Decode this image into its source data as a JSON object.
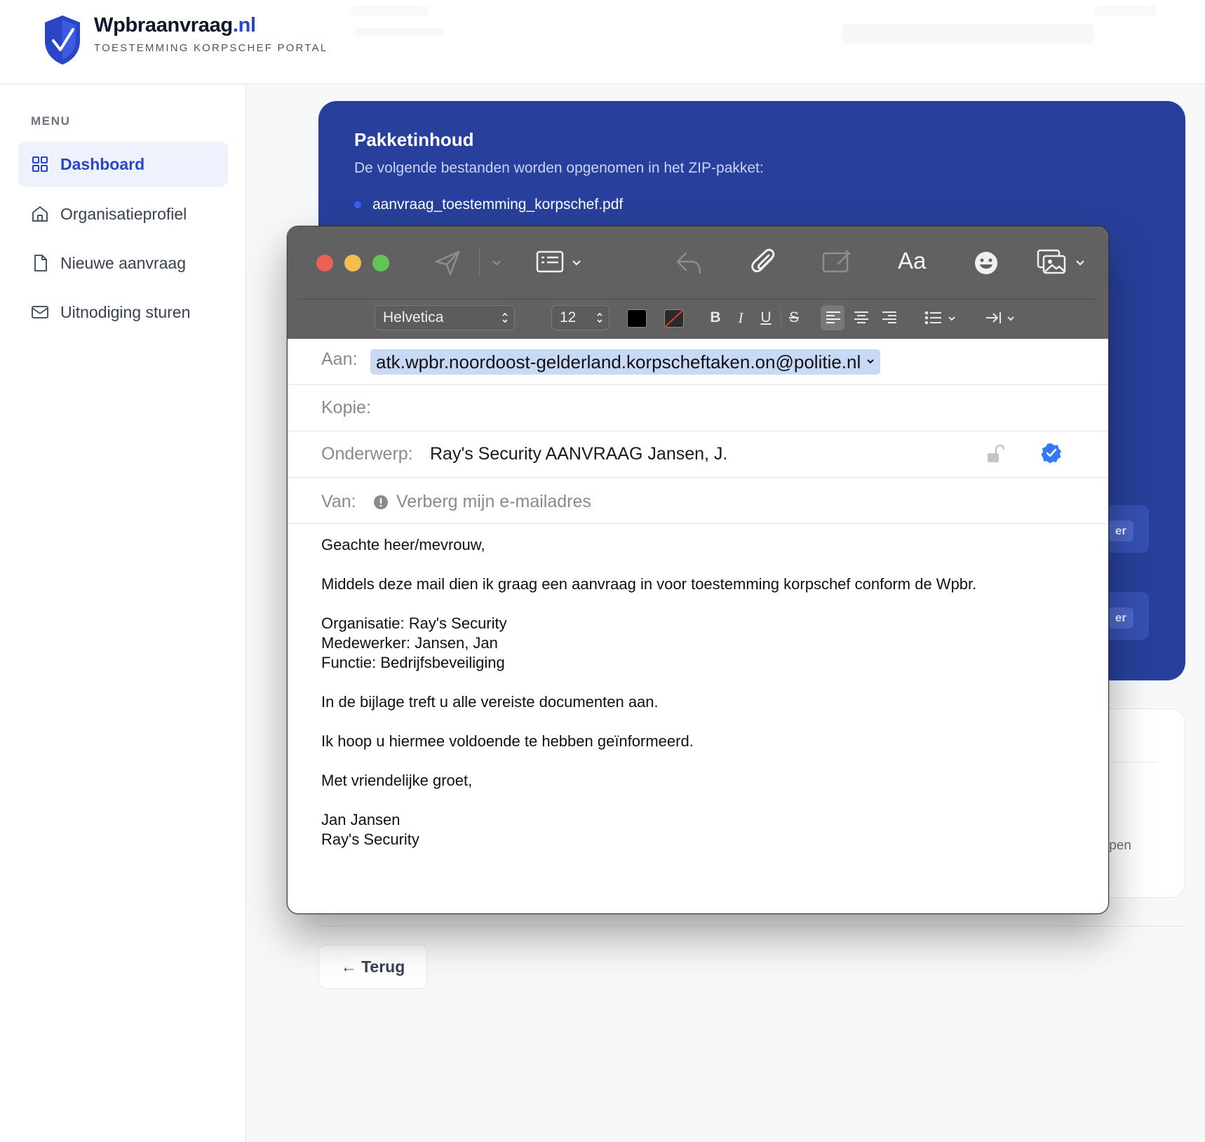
{
  "header": {
    "brand_name": "Wpbraanvraag",
    "brand_tld": ".nl",
    "subtitle": "TOESTEMMING KORPSCHEF PORTAL"
  },
  "sidebar": {
    "menu_label": "MENU",
    "items": [
      {
        "label": "Dashboard",
        "icon": "grid-icon",
        "active": true
      },
      {
        "label": "Organisatieprofiel",
        "icon": "home-icon",
        "active": false
      },
      {
        "label": "Nieuwe aanvraag",
        "icon": "document-icon",
        "active": false
      },
      {
        "label": "Uitnodiging sturen",
        "icon": "mail-icon",
        "active": false
      }
    ]
  },
  "package": {
    "title": "Pakketinhoud",
    "description": "De volgende bestanden worden opgenomen in het ZIP-pakket:",
    "files": [
      "aanvraag_toestemming_korpschef.pdf"
    ],
    "button_fragment_1": "er",
    "button_fragment_2": "er"
  },
  "card_fragment": "pen",
  "back_button": "← Terug",
  "mail": {
    "font": "Helvetica",
    "font_size": "12",
    "aa_label": "Aa",
    "to_label": "Aan:",
    "to_value": "atk.wpbr.noordoost-gelderland.korpscheftaken.on@politie.nl",
    "cc_label": "Kopie:",
    "subject_label": "Onderwerp:",
    "subject_value": "Ray's Security AANVRAAG Jansen, J.",
    "from_label": "Van:",
    "from_value": "Verberg mijn e-mailadres",
    "body": {
      "greeting": "Geachte heer/mevrouw,",
      "intro": "Middels deze mail dien ik graag een aanvraag in voor toestemming korpschef conform de Wpbr.",
      "org": "Organisatie: Ray's Security",
      "employee": "Medewerker: Jansen, Jan",
      "function": "Functie: Bedrijfsbeveiliging",
      "attachments": "In de bijlage treft u alle vereiste documenten aan.",
      "closing_hope": "Ik hoop u hiermee voldoende te hebben geïnformeerd.",
      "regards": "Met vriendelijke groet,",
      "sig_name": "Jan Jansen",
      "sig_company": "Ray's Security"
    },
    "format_buttons": {
      "bold": "B",
      "italic": "I",
      "underline": "U",
      "strike": "S"
    },
    "colors": {
      "toolbar": "#616161",
      "token": "#c8d9f5",
      "verified": "#3478f6"
    }
  }
}
